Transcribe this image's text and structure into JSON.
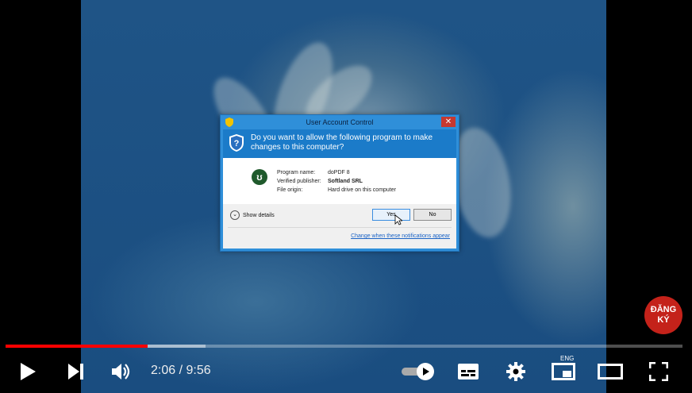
{
  "uac": {
    "title": "User Account Control",
    "close": "✕",
    "question": "Do you want to allow the following program to make changes to this computer?",
    "fields": [
      {
        "key": "Program name:",
        "value": "doPDF 8"
      },
      {
        "key": "Verified publisher:",
        "value": "Softland SRL"
      },
      {
        "key": "File origin:",
        "value": "Hard drive on this computer"
      }
    ],
    "app_icon_glyph": "ʊ",
    "show_details": "Show details",
    "yes": "Yes",
    "no": "No",
    "change_link": "Change when these notifications appear"
  },
  "subscribe": {
    "line1": "ĐĂNG",
    "line2": "KÝ"
  },
  "player": {
    "current_time": "2:06",
    "duration": "9:56",
    "time_display": "2:06 / 9:56",
    "played_fraction": 0.21,
    "buffered_fraction": 0.295,
    "caption_lang": "ENG",
    "icons": [
      "play-icon",
      "next-icon",
      "volume-icon",
      "autoplay-toggle",
      "subtitles-icon",
      "settings-icon",
      "miniplayer-icon",
      "theater-icon",
      "fullscreen-icon"
    ]
  },
  "colors": {
    "progress": "#ff0000",
    "subscribe": "#c4221a",
    "uac_blue": "#1b7bc9"
  }
}
